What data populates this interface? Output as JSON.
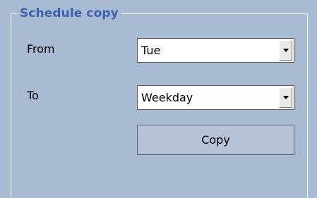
{
  "schedule_copy": {
    "title": "Schedule copy",
    "from": {
      "label": "From",
      "value": "Tue"
    },
    "to": {
      "label": "To",
      "value": "Weekday"
    },
    "copy_button_label": "Copy"
  },
  "icons": {
    "dropdown": "chevron-down-icon"
  },
  "colors": {
    "panel_background": "#a9bad3",
    "title_text": "#3d62ad",
    "button_background": "#b5c2d7"
  }
}
